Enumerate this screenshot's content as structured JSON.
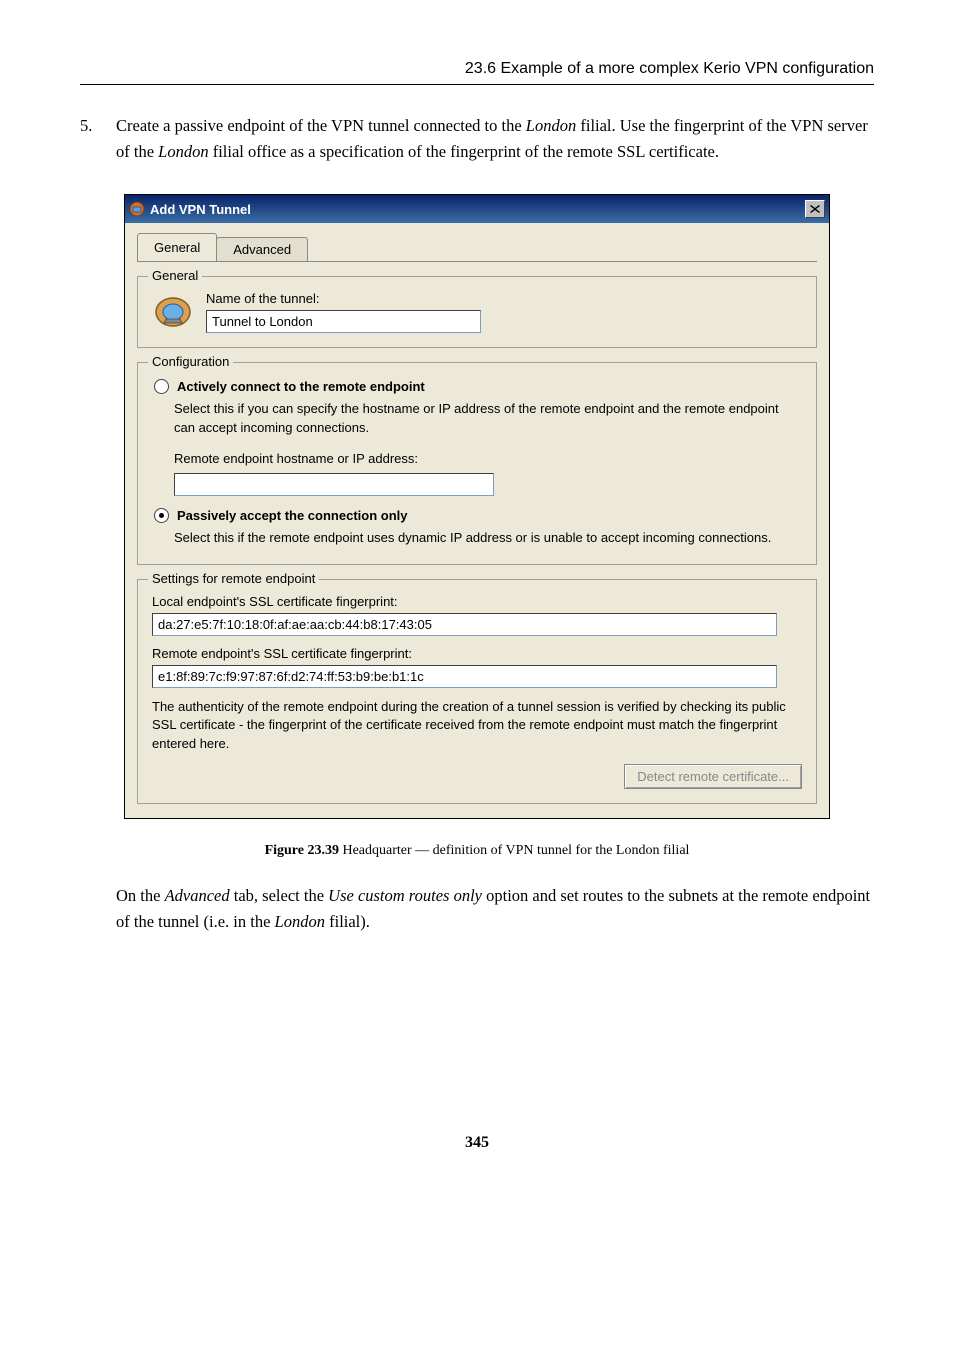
{
  "header": {
    "section": "23.6  Example of a more complex Kerio VPN configuration"
  },
  "step": {
    "number": "5.",
    "text_before_italic1": "Create a passive endpoint of the VPN tunnel connected to the ",
    "italic1": "London",
    "text_mid": " filial. Use the fingerprint of the VPN server of the ",
    "italic2": "London",
    "text_after": " filial office as a specification of the fingerprint of the remote SSL certificate."
  },
  "dialog": {
    "title": "Add VPN Tunnel",
    "tabs": {
      "general": "General",
      "advanced": "Advanced"
    },
    "general_group": {
      "legend": "General",
      "name_label": "Name of the tunnel:",
      "name_value": "Tunnel to London"
    },
    "config_group": {
      "legend": "Configuration",
      "radio_active": "Actively connect to the remote endpoint",
      "active_desc": "Select this if you can specify the hostname or IP address of the remote endpoint and the remote endpoint can accept incoming connections.",
      "remote_label": "Remote endpoint hostname or IP address:",
      "remote_value": "",
      "radio_passive": "Passively accept the connection only",
      "passive_desc": "Select this if the remote endpoint uses dynamic IP address or is unable to accept incoming connections."
    },
    "settings_group": {
      "legend": "Settings for remote endpoint",
      "local_label": "Local endpoint's SSL certificate fingerprint:",
      "local_value": "da:27:e5:7f:10:18:0f:af:ae:aa:cb:44:b8:17:43:05",
      "remote_label": "Remote endpoint's SSL certificate fingerprint:",
      "remote_value": "e1:8f:89:7c:f9:97:87:6f:d2:74:ff:53:b9:be:b1:1c",
      "auth_note": "The authenticity of the remote endpoint during the creation of a tunnel session is verified by checking its public SSL certificate - the fingerprint of the certificate received from the remote endpoint must match the fingerprint entered here.",
      "detect_button": "Detect remote certificate..."
    }
  },
  "caption": {
    "label": "Figure 23.39",
    "text": "   Headquarter — definition of VPN tunnel for the London filial"
  },
  "after": {
    "t1": "On the ",
    "i1": "Advanced",
    "t2": " tab, select the ",
    "i2": "Use custom routes only",
    "t3": " option and set routes to the subnets at the remote endpoint of the tunnel (i.e. in the ",
    "i3": "London",
    "t4": " filial)."
  },
  "page_number": "345"
}
